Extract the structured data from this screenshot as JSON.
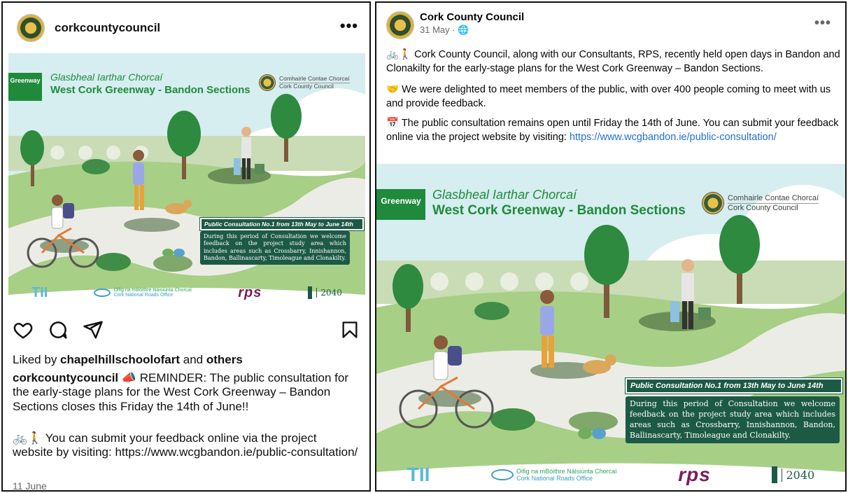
{
  "instagram": {
    "username": "corkcountycouncil",
    "more": "•••",
    "liked_by_prefix": "Liked by ",
    "liked_by_user": "chapelhillschoolofart",
    "liked_by_and": " and ",
    "liked_by_others": "others",
    "caption_user": "corkcountycouncil",
    "caption_emoji": "📣",
    "caption_text": " REMINDER: The public consultation for the early-stage plans for the West Cork Greenway – Bandon Sections closes this Friday the 14th of June!!",
    "feedback_emoji": "🚲🚶",
    "feedback_text": " You can submit your feedback online via the project website by visiting: https://www.wcgbandon.ie/public-consultation/",
    "date": "11 June"
  },
  "facebook": {
    "page_name": "Cork County Council",
    "date": "31 May · ",
    "audience_icon": "globe-icon",
    "more": "•••",
    "p1_emoji": "🚲🚶",
    "p1": " Cork County Council, along with our Consultants, RPS, recently held open days in Bandon and Clonakilty for the early-stage plans for the West Cork Greenway – Bandon Sections.",
    "p2_emoji": "🤝",
    "p2": " We were delighted to meet members of the public, with over 400 people coming to meet with us and provide feedback.",
    "p3_emoji": "📅",
    "p3": " The public consultation remains open until Friday the 14th of June. You can submit your feedback online  via the project website by visiting: ",
    "p3_link": "https://www.wcgbandon.ie/public-consultation/"
  },
  "poster": {
    "greenway_logo": "Greenway",
    "title_irish": "Glasbheal Iarthar Chorcaí",
    "title_english": "West Cork Greenway - Bandon Sections",
    "council_irish": "Comhairle Contae Chorcaí",
    "council_english": "Cork County Council",
    "notice_heading": "Public Consultation No.1 from 13th May to June 14th",
    "notice_body": "During this period of Consultation we welcome feedback on the project study area which includes areas such as Crossbarry, Innishannon, Bandon, Ballinascarty, Timoleague and Clonakilty.",
    "partner_tii": "TII",
    "partner_nro_irish": "Oifig na mBóithre Náisiúnta Chorcaí",
    "partner_nro_english": "Cork National Roads Office",
    "partner_rps": "rps",
    "partner_gov_year": "2040"
  },
  "colors": {
    "greenway_green": "#1f8a3b",
    "notice_green": "#1d5a46",
    "link_blue": "#216fdb",
    "sky": "#d6eef0",
    "grass": "#a7cf86"
  }
}
